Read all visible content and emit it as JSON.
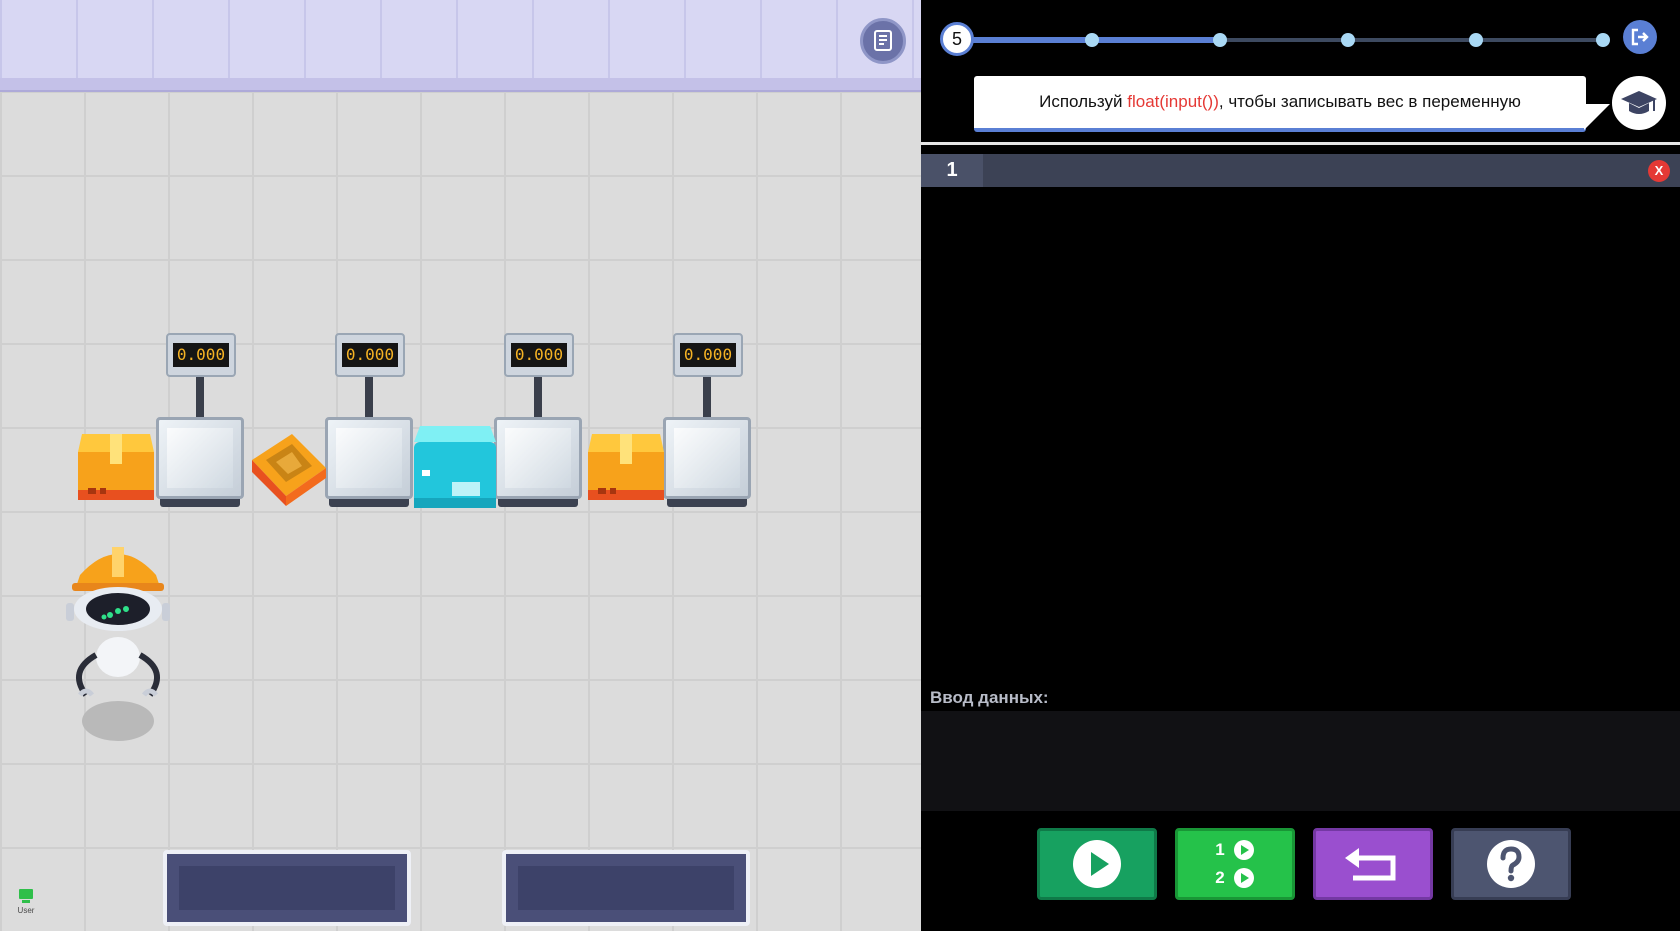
{
  "game": {
    "scales": [
      {
        "reading": "0.000"
      },
      {
        "reading": "0.000"
      },
      {
        "reading": "0.000"
      },
      {
        "reading": "0.000"
      }
    ],
    "user_label": "User"
  },
  "editor": {
    "level": "5",
    "hint": {
      "prefix": "Используй ",
      "code": "float(input())",
      "suffix": ", чтобы записывать вес в переменную"
    },
    "tab_label": "1",
    "close_label": "X",
    "input_label": "Ввод данных:",
    "step_labels": [
      "1",
      "2"
    ]
  },
  "colors": {
    "accent": "#5a7fd4",
    "run": "#17a160",
    "step": "#25c24a",
    "reset": "#9a4fcf",
    "help": "#4d5570",
    "code_highlight": "#e53935"
  }
}
